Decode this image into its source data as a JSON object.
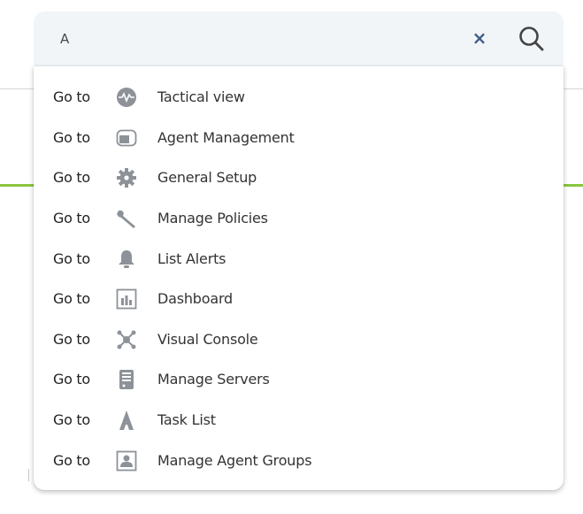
{
  "search": {
    "value": "A",
    "clear_glyph": "×"
  },
  "results": [
    {
      "prefix": "Go to",
      "label": "Tactical view",
      "icon": "tactical-view-icon"
    },
    {
      "prefix": "Go to",
      "label": "Agent Management",
      "icon": "agent-management-icon"
    },
    {
      "prefix": "Go to",
      "label": "General Setup",
      "icon": "gear-icon"
    },
    {
      "prefix": "Go to",
      "label": "Manage Policies",
      "icon": "wrench-icon"
    },
    {
      "prefix": "Go to",
      "label": "List Alerts",
      "icon": "bell-icon"
    },
    {
      "prefix": "Go to",
      "label": "Dashboard",
      "icon": "dashboard-icon"
    },
    {
      "prefix": "Go to",
      "label": "Visual Console",
      "icon": "visual-console-icon"
    },
    {
      "prefix": "Go to",
      "label": "Manage Servers",
      "icon": "server-icon"
    },
    {
      "prefix": "Go to",
      "label": "Task List",
      "icon": "task-list-icon"
    },
    {
      "prefix": "Go to",
      "label": "Manage Agent Groups",
      "icon": "agent-groups-icon"
    }
  ],
  "colors": {
    "accent_green": "#8bc63f",
    "clear_blue": "#3f5f86",
    "icon_gray": "#8d9299"
  }
}
